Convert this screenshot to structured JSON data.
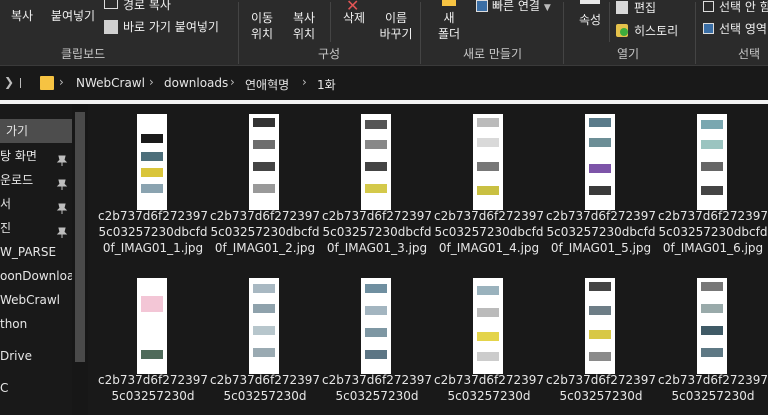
{
  "ribbon": {
    "clipboard": {
      "copy_label": "복사",
      "paste_label": "붙여넣기",
      "copy_path_label": "경로 복사",
      "paste_shortcut_label": "바로 가기 붙여넣기",
      "group_label": "클립보드"
    },
    "organize": {
      "move_label": [
        "이동",
        "위치"
      ],
      "copy_to_label": [
        "복사",
        "위치"
      ],
      "delete_label": "삭제",
      "rename_label": [
        "이름",
        "바꾸기"
      ],
      "group_label": "구성"
    },
    "new": {
      "new_folder_label": [
        "새",
        "폴더"
      ],
      "easy_access_label": "빠른 연결",
      "group_label": "새로 만들기"
    },
    "open": {
      "properties_label": "속성",
      "edit_label": "편집",
      "history_label": "히스토리",
      "group_label": "열기"
    },
    "select": {
      "select_all_label": "선택 안 함",
      "invert_label": "선택 영역",
      "group_label": "선택"
    }
  },
  "address": {
    "crumbs": [
      "NWebCrawl",
      "downloads",
      "연애혁명",
      "1화"
    ]
  },
  "nav": {
    "items": [
      {
        "label": "가기",
        "pinned": false,
        "selected": true
      },
      {
        "label": "탕 화면",
        "pinned": true,
        "selected": false
      },
      {
        "label": "운로드",
        "pinned": true,
        "selected": false
      },
      {
        "label": "서",
        "pinned": true,
        "selected": false
      },
      {
        "label": "진",
        "pinned": true,
        "selected": false
      },
      {
        "label": "W_PARSE",
        "pinned": false,
        "selected": false
      },
      {
        "label": "oonDownload",
        "pinned": false,
        "selected": false
      },
      {
        "label": "WebCrawl",
        "pinned": false,
        "selected": false
      },
      {
        "label": "thon",
        "pinned": false,
        "selected": false
      },
      {
        "label": "Drive",
        "pinned": false,
        "selected": false
      },
      {
        "label": "C",
        "pinned": false,
        "selected": false
      }
    ]
  },
  "files": [
    {
      "name": "c2b737d6f2723975c03257230dbcfd0f_IMAG01_1.jpg"
    },
    {
      "name": "c2b737d6f2723975c03257230dbcfd0f_IMAG01_2.jpg"
    },
    {
      "name": "c2b737d6f2723975c03257230dbcfd0f_IMAG01_3.jpg"
    },
    {
      "name": "c2b737d6f2723975c03257230dbcfd0f_IMAG01_4.jpg"
    },
    {
      "name": "c2b737d6f2723975c03257230dbcfd0f_IMAG01_5.jpg"
    },
    {
      "name": "c2b737d6f2723975c03257230dbcfd0f_IMAG01_6.jpg"
    },
    {
      "name": "c2b737d6f2723975c03257230d"
    },
    {
      "name": "c2b737d6f2723975c03257230d"
    },
    {
      "name": "c2b737d6f2723975c03257230d"
    },
    {
      "name": "c2b737d6f2723975c03257230d"
    },
    {
      "name": "c2b737d6f2723975c03257230d"
    },
    {
      "name": "c2b737d6f2723975c03257230d"
    }
  ],
  "colors": {
    "background": "#191919",
    "ribbon": "#2b2b2b",
    "folder": "#f6c342",
    "selected_nav": "#4d4d4d"
  }
}
